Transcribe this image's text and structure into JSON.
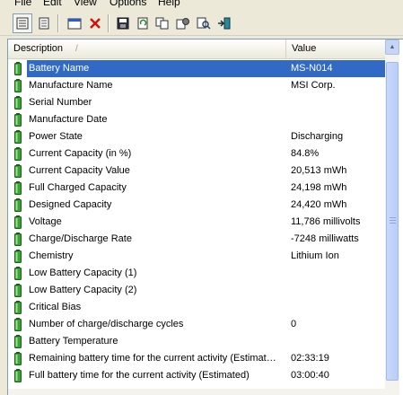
{
  "menu": [
    "File",
    "Edit",
    "View",
    "Options",
    "Help"
  ],
  "toolbar": {
    "buttons": [
      "view-icon",
      "report-icon",
      "window-icon",
      "delete-icon",
      "save-icon",
      "refresh-icon",
      "copy-icon",
      "properties-icon",
      "find-icon",
      "exit-icon"
    ]
  },
  "columns": {
    "description": "Description",
    "value": "Value"
  },
  "rows": [
    {
      "desc": "Battery Name",
      "value": "MS-N014",
      "selected": true
    },
    {
      "desc": "Manufacture Name",
      "value": "MSI Corp."
    },
    {
      "desc": "Serial Number",
      "value": ""
    },
    {
      "desc": "Manufacture Date",
      "value": ""
    },
    {
      "desc": "Power State",
      "value": "Discharging"
    },
    {
      "desc": "Current Capacity (in %)",
      "value": "84.8%"
    },
    {
      "desc": "Current Capacity Value",
      "value": "20,513 mWh"
    },
    {
      "desc": "Full Charged Capacity",
      "value": "24,198 mWh"
    },
    {
      "desc": "Designed Capacity",
      "value": "24,420 mWh"
    },
    {
      "desc": "Voltage",
      "value": "11,786 millivolts"
    },
    {
      "desc": "Charge/Discharge Rate",
      "value": "-7248 milliwatts"
    },
    {
      "desc": "Chemistry",
      "value": "Lithium Ion"
    },
    {
      "desc": "Low Battery Capacity (1)",
      "value": ""
    },
    {
      "desc": "Low Battery Capacity (2)",
      "value": ""
    },
    {
      "desc": "Critical Bias",
      "value": ""
    },
    {
      "desc": "Number of charge/discharge cycles",
      "value": "0"
    },
    {
      "desc": "Battery Temperature",
      "value": ""
    },
    {
      "desc": "Remaining battery time for the current activity (Estimated)",
      "value": "02:33:19"
    },
    {
      "desc": "Full battery time for the current activity (Estimated)",
      "value": "03:00:40"
    }
  ],
  "colors": {
    "selection": "#316ac5",
    "battery": "#3aa335"
  }
}
